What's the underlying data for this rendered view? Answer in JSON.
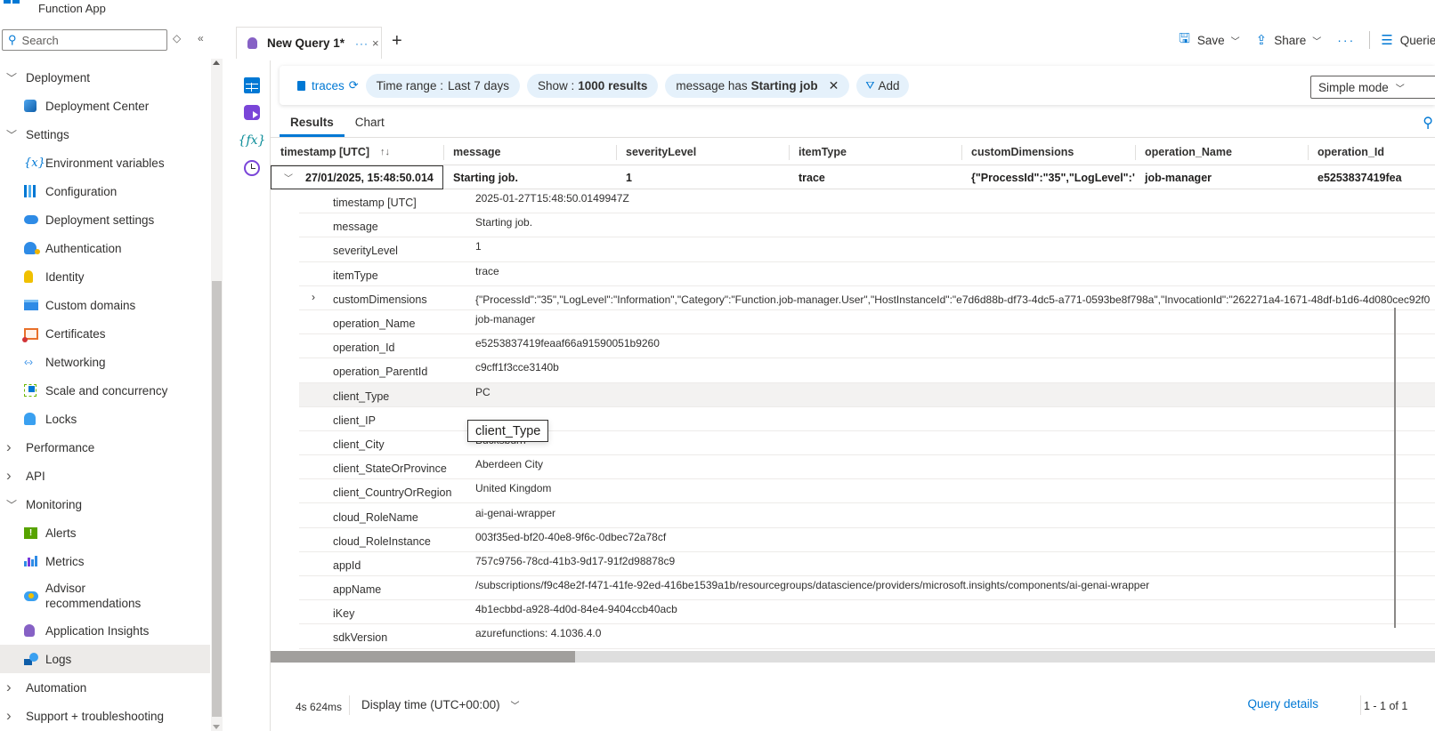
{
  "app": {
    "title": "Function App"
  },
  "sidebar": {
    "search_placeholder": "Search",
    "items": [
      {
        "type": "group",
        "label": "Deployment",
        "expanded": true,
        "icon": "chevron-down-icon"
      },
      {
        "type": "child",
        "label": "Deployment Center",
        "icon": "deployment-center-icon"
      },
      {
        "type": "group",
        "label": "Settings",
        "expanded": true,
        "icon": "chevron-down-icon"
      },
      {
        "type": "child",
        "label": "Environment variables",
        "icon": "environment-variables-icon"
      },
      {
        "type": "child",
        "label": "Configuration",
        "icon": "configuration-icon"
      },
      {
        "type": "child",
        "label": "Deployment settings",
        "icon": "deployment-settings-icon"
      },
      {
        "type": "child",
        "label": "Authentication",
        "icon": "authentication-icon"
      },
      {
        "type": "child",
        "label": "Identity",
        "icon": "identity-icon"
      },
      {
        "type": "child",
        "label": "Custom domains",
        "icon": "custom-domains-icon"
      },
      {
        "type": "child",
        "label": "Certificates",
        "icon": "certificates-icon"
      },
      {
        "type": "child",
        "label": "Networking",
        "icon": "networking-icon"
      },
      {
        "type": "child",
        "label": "Scale and concurrency",
        "icon": "scale-icon"
      },
      {
        "type": "child",
        "label": "Locks",
        "icon": "lock-icon"
      },
      {
        "type": "group",
        "label": "Performance",
        "expanded": false,
        "icon": "chevron-right-icon"
      },
      {
        "type": "group",
        "label": "API",
        "expanded": false,
        "icon": "chevron-right-icon"
      },
      {
        "type": "group",
        "label": "Monitoring",
        "expanded": true,
        "icon": "chevron-down-icon"
      },
      {
        "type": "child",
        "label": "Alerts",
        "icon": "alerts-icon"
      },
      {
        "type": "child",
        "label": "Metrics",
        "icon": "metrics-icon"
      },
      {
        "type": "child",
        "label": "Advisor recommendations",
        "icon": "advisor-icon"
      },
      {
        "type": "child",
        "label": "Application Insights",
        "icon": "application-insights-icon"
      },
      {
        "type": "child",
        "label": "Logs",
        "icon": "logs-icon",
        "active": true
      },
      {
        "type": "group",
        "label": "Automation",
        "expanded": false,
        "icon": "chevron-right-icon"
      },
      {
        "type": "group",
        "label": "Support + troubleshooting",
        "expanded": false,
        "icon": "chevron-right-icon"
      }
    ]
  },
  "query_tab": {
    "name": "New Query 1*",
    "more": "···",
    "close": "×",
    "add": "+"
  },
  "toolbar": {
    "save_label": "Save",
    "share_label": "Share",
    "more": "···",
    "queries_label": "Queries"
  },
  "query_bar": {
    "table": "traces",
    "time_range_label": "Time range :",
    "time_range_value": "Last 7 days",
    "show_label": "Show :",
    "show_value": "1000 results",
    "filter_label": "message has",
    "filter_value": "Starting job",
    "add_label": "Add",
    "mode": "Simple mode"
  },
  "results_tabs": [
    {
      "label": "Results",
      "active": true
    },
    {
      "label": "Chart",
      "active": false
    }
  ],
  "grid": {
    "columns": [
      "timestamp [UTC]",
      "message",
      "severityLevel",
      "itemType",
      "customDimensions",
      "operation_Name",
      "operation_Id"
    ],
    "row": [
      "27/01/2025, 15:48:50.014",
      "Starting job.",
      "1",
      "trace",
      "{\"ProcessId\":\"35\",\"LogLevel\":\"I...",
      "job-manager",
      "e5253837419fea"
    ],
    "details": [
      {
        "key": "timestamp [UTC]",
        "value": "2025-01-27T15:48:50.0149947Z"
      },
      {
        "key": "message",
        "value": "Starting job."
      },
      {
        "key": "severityLevel",
        "value": "1"
      },
      {
        "key": "itemType",
        "value": "trace"
      },
      {
        "key": "customDimensions",
        "value": "{\"ProcessId\":\"35\",\"LogLevel\":\"Information\",\"Category\":\"Function.job-manager.User\",\"HostInstanceId\":\"e7d6d88b-df73-4dc5-a771-0593be8f798a\",\"InvocationId\":\"262271a4-1671-48df-b1d6-4d080cec92f0",
        "expandable": true
      },
      {
        "key": "operation_Name",
        "value": "job-manager"
      },
      {
        "key": "operation_Id",
        "value": "e5253837419feaaf66a91590051b9260"
      },
      {
        "key": "operation_ParentId",
        "value": "c9cff1f3cce3140b"
      },
      {
        "key": "client_Type",
        "value": "PC",
        "hover": true
      },
      {
        "key": "client_IP",
        "value": ""
      },
      {
        "key": "client_City",
        "value": "Bucksburn"
      },
      {
        "key": "client_StateOrProvince",
        "value": "Aberdeen City"
      },
      {
        "key": "client_CountryOrRegion",
        "value": "United Kingdom"
      },
      {
        "key": "cloud_RoleName",
        "value": "ai-genai-wrapper"
      },
      {
        "key": "cloud_RoleInstance",
        "value": "003f35ed-bf20-40e8-9f6c-0dbec72a78cf"
      },
      {
        "key": "appId",
        "value": "757c9756-78cd-41b3-9d17-91f2d98878c9"
      },
      {
        "key": "appName",
        "value": "/subscriptions/f9c48e2f-f471-41fe-92ed-416be1539a1b/resourcegroups/datascience/providers/microsoft.insights/components/ai-genai-wrapper"
      },
      {
        "key": "iKey",
        "value": "4b1ecbbd-a928-4d0d-84e4-9404ccb40acb"
      },
      {
        "key": "sdkVersion",
        "value": "azurefunctions: 4.1036.4.0"
      }
    ]
  },
  "tooltip": {
    "text": "client_Type"
  },
  "footer": {
    "exec_time": "4s 624ms",
    "display_time": "Display time (UTC+00:00)",
    "query_details": "Query details",
    "pagination": "1 - 1 of 1"
  },
  "colors": {
    "accent": "#0078d4",
    "pill_bg": "#e5f1fb",
    "active_nav": "#edebe9"
  }
}
